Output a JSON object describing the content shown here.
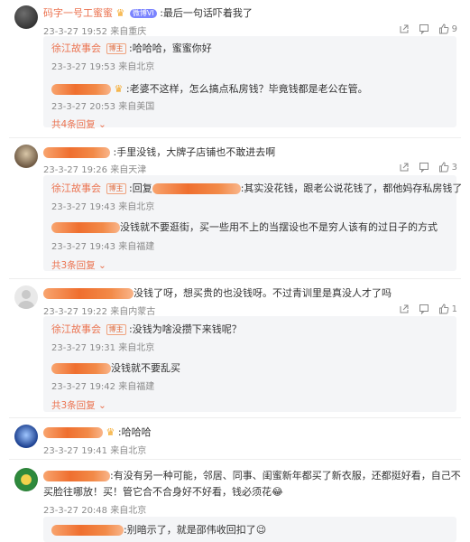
{
  "comments": [
    {
      "author": "码字一号工蜜蜜",
      "vip_badge": "微博VI",
      "text": ":最后一句话吓着我了",
      "time": "23-3-27 19:52",
      "location": "来自重庆",
      "likes": "9",
      "replies": [
        {
          "author": "徐江故事会",
          "badge": "博主",
          "text": ":哈哈哈，蜜蜜你好",
          "time": "23-3-27 19:53",
          "location": "来自北京"
        },
        {
          "author": "",
          "text": ":老婆不这样，怎么搞点私房钱？毕竟钱都是老公在管。",
          "time": "23-3-27 20:53",
          "location": "来自美国"
        }
      ],
      "more": "共4条回复"
    },
    {
      "author": "",
      "text": ":手里没钱，大牌子店铺也不敢进去啊",
      "time": "23-3-27 19:26",
      "location": "来自天津",
      "likes": "3",
      "replies": [
        {
          "author": "徐江故事会",
          "badge": "博主",
          "prefix": ":回复",
          "text": ":其实没花钱，跟老公说花钱了，都他妈存私房钱了",
          "time": "23-3-27 19:43",
          "location": "来自北京"
        },
        {
          "author": "",
          "text": "没钱就不要逛街，买一些用不上的当摆设也不是穷人该有的过日子的方式",
          "time": "23-3-27 19:43",
          "location": "来自福建"
        }
      ],
      "more": "共3条回复"
    },
    {
      "author": "",
      "text": "没钱了呀，想买贵的也没钱呀。不过青训里是真没人才了吗",
      "time": "23-3-27 19:22",
      "location": "来自内蒙古",
      "likes": "1",
      "replies": [
        {
          "author": "徐江故事会",
          "badge": "博主",
          "text": ":没钱为啥没攒下来钱呢？",
          "time": "23-3-27 19:31",
          "location": "来自北京"
        },
        {
          "author": "",
          "text": "没钱就不要乱买",
          "time": "23-3-27 19:42",
          "location": "来自福建"
        }
      ],
      "more": "共3条回复"
    },
    {
      "author": "",
      "text": ":哈哈哈",
      "time": "23-3-27 19:41",
      "location": "来自北京"
    },
    {
      "author": "",
      "text_line1": ":有没有另一种可能，邻居、同事、闺蜜新年都买了新衣服，还都挺好看，自己不",
      "text_line2": "买脸往哪放！买！管它合不合身好不好看，钱必须花😂",
      "time": "23-3-27 20:48",
      "location": "来自北京",
      "reply_partial": ":别暗示了，就是邵伟收回扣了😉"
    }
  ]
}
